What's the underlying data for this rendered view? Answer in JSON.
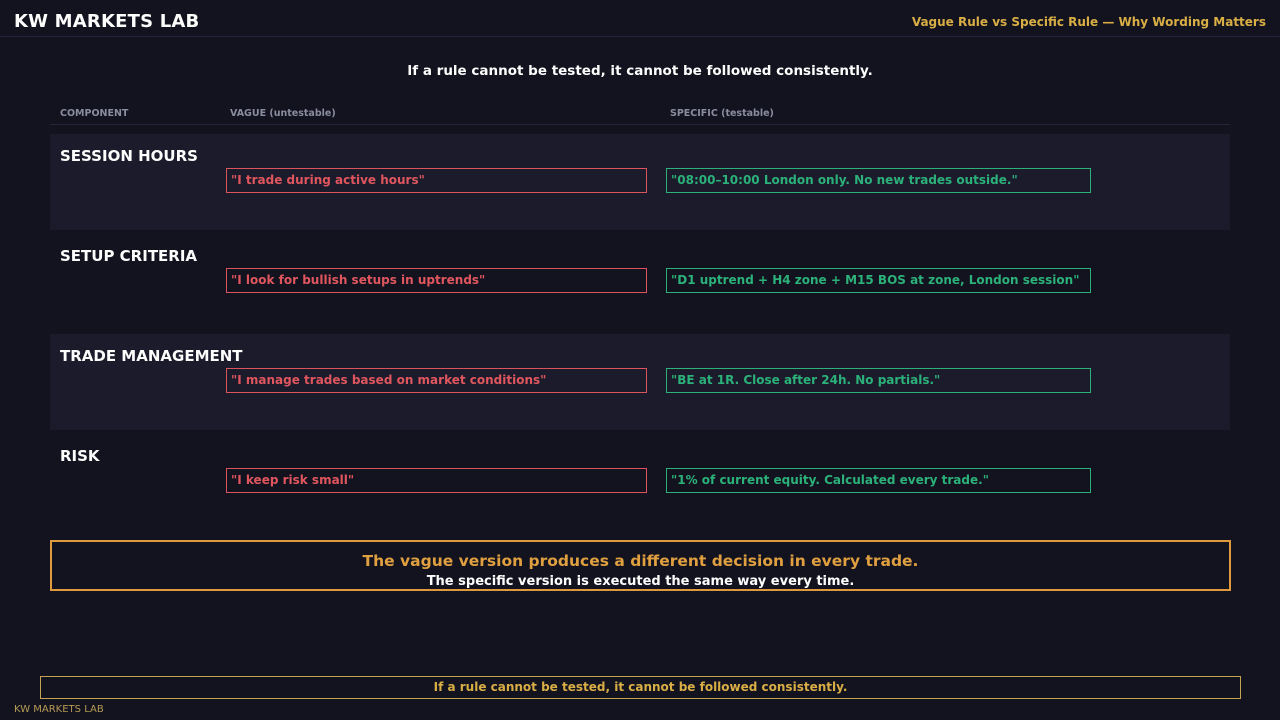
{
  "header": {
    "brand": "KW MARKETS LAB",
    "subtitle": "Vague Rule vs Specific Rule — Why Wording Matters"
  },
  "statement": "If a rule cannot be tested, it cannot be followed consistently.",
  "columns": {
    "component": "COMPONENT",
    "vague": "VAGUE (untestable)",
    "specific": "SPECIFIC (testable)"
  },
  "rows": [
    {
      "label": "SESSION HOURS",
      "vague": "\"I trade during active hours\"",
      "specific": "\"08:00–10:00 London only. No new trades outside.\""
    },
    {
      "label": "SETUP CRITERIA",
      "vague": "\"I look for bullish setups in uptrends\"",
      "specific": "\"D1 uptrend + H4 zone + M15 BOS at zone, London session\""
    },
    {
      "label": "TRADE MANAGEMENT",
      "vague": "\"I manage trades based on market conditions\"",
      "specific": "\"BE at 1R. Close after 24h. No partials.\""
    },
    {
      "label": "RISK",
      "vague": "\"I keep risk small\"",
      "specific": "\"1% of current equity. Calculated every trade.\""
    }
  ],
  "callout": {
    "main": "The vague version produces a different decision in every trade.",
    "sub": "The specific version is executed the same way every time."
  },
  "footer": {
    "statement": "If a rule cannot be tested, it cannot be followed consistently.",
    "brand": "KW MARKETS LAB"
  },
  "colors": {
    "background": "#13131f",
    "vague": "#e0565e",
    "specific": "#2bb179",
    "accent": "#e09a3e",
    "gold": "#d9ae45"
  }
}
